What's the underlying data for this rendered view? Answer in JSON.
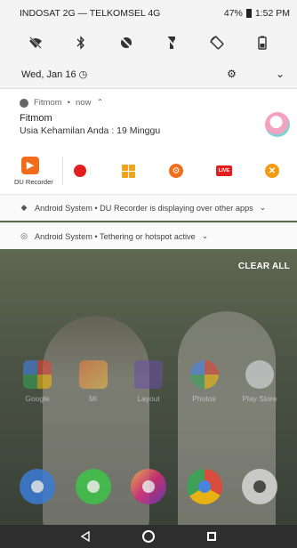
{
  "status_bar": {
    "carrier": "INDOSAT 2G — TELKOMSEL 4G",
    "battery_percent": "47%",
    "time": "1:52 PM"
  },
  "quick_settings": {
    "icons": [
      "wifi-off-icon",
      "bluetooth-icon",
      "do-not-disturb-icon",
      "flashlight-off-icon",
      "auto-rotate-icon",
      "battery-saver-icon"
    ],
    "date": "Wed, Jan 16"
  },
  "notifications": {
    "fitmom": {
      "app_name": "Fitmom",
      "time": "now",
      "title": "Fitmom",
      "body": "Usia Kehamilan Anda : 19 Minggu"
    },
    "du_recorder": {
      "app_label": "DU Recorder"
    },
    "system1": {
      "text": "Android System • DU Recorder is displaying over other apps"
    },
    "system2": {
      "text": "Android System • Tethering or hotspot active"
    },
    "clear_all": "CLEAR ALL"
  },
  "home": {
    "apps": [
      {
        "label": "Google"
      },
      {
        "label": "Mi"
      },
      {
        "label": "Layout"
      },
      {
        "label": "Photos"
      },
      {
        "label": "Play Store"
      }
    ]
  }
}
